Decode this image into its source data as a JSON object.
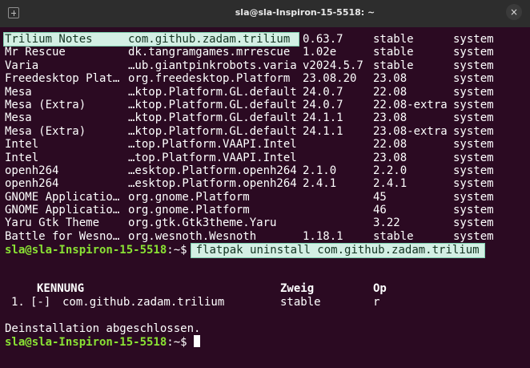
{
  "window": {
    "title": "sla@sla-Inspiron-15-5518: ~",
    "close_symbol": "×",
    "new_tab_icon": "new-tab-icon",
    "colors": {
      "background": "#2b0a22",
      "titlebar": "#2d2d2d",
      "prompt": "#8ae234",
      "highlight": "#d3efe4"
    }
  },
  "apps_table": {
    "rows": [
      {
        "name": "Trilium Notes",
        "id": "com.github.zadam.trilium",
        "version": "0.63.7",
        "branch": "stable",
        "installation": "system"
      },
      {
        "name": "Mr Rescue",
        "id": "dk.tangramgames.mrrescue",
        "version": "1.02e",
        "branch": "stable",
        "installation": "system"
      },
      {
        "name": "Varia",
        "id": "…ub.giantpinkrobots.varia",
        "version": "v2024.5.7",
        "branch": "stable",
        "installation": "system"
      },
      {
        "name": "Freedesktop Plat…",
        "id": "org.freedesktop.Platform",
        "version": "23.08.20",
        "branch": "23.08",
        "installation": "system"
      },
      {
        "name": "Mesa",
        "id": "…ktop.Platform.GL.default",
        "version": "24.0.7",
        "branch": "22.08",
        "installation": "system"
      },
      {
        "name": "Mesa (Extra)",
        "id": "…ktop.Platform.GL.default",
        "version": "24.0.7",
        "branch": "22.08-extra",
        "installation": "system"
      },
      {
        "name": "Mesa",
        "id": "…ktop.Platform.GL.default",
        "version": "24.1.1",
        "branch": "23.08",
        "installation": "system"
      },
      {
        "name": "Mesa (Extra)",
        "id": "…ktop.Platform.GL.default",
        "version": "24.1.1",
        "branch": "23.08-extra",
        "installation": "system"
      },
      {
        "name": "Intel",
        "id": "…top.Platform.VAAPI.Intel",
        "version": "",
        "branch": "22.08",
        "installation": "system"
      },
      {
        "name": "Intel",
        "id": "…top.Platform.VAAPI.Intel",
        "version": "",
        "branch": "23.08",
        "installation": "system"
      },
      {
        "name": "openh264",
        "id": "…esktop.Platform.openh264",
        "version": "2.1.0",
        "branch": "2.2.0",
        "installation": "system"
      },
      {
        "name": "openh264",
        "id": "…esktop.Platform.openh264",
        "version": "2.4.1",
        "branch": "2.4.1",
        "installation": "system"
      },
      {
        "name": "GNOME Applicatio…",
        "id": "org.gnome.Platform",
        "version": "",
        "branch": "45",
        "installation": "system"
      },
      {
        "name": "GNOME Applicatio…",
        "id": "org.gnome.Platform",
        "version": "",
        "branch": "46",
        "installation": "system"
      },
      {
        "name": "Yaru Gtk Theme",
        "id": "org.gtk.Gtk3theme.Yaru",
        "version": "",
        "branch": "3.22",
        "installation": "system"
      },
      {
        "name": "Battle for Wesno…",
        "id": "org.wesnoth.Wesnoth",
        "version": "1.18.1",
        "branch": "stable",
        "installation": "system"
      }
    ]
  },
  "command": {
    "prompt": "sla@sla-Inspiron-15-5518",
    "suffix": ":~$",
    "text": "flatpak uninstall com.github.zadam.trilium"
  },
  "uninstall_table": {
    "headers": {
      "id": "KENNUNG",
      "branch": "Zweig",
      "op": "Op"
    },
    "rows": [
      {
        "index": "1.",
        "mark": "[-]",
        "id": "com.github.zadam.trilium",
        "branch": "stable",
        "op": "r"
      }
    ]
  },
  "result_message": "Deinstallation abgeschlossen.",
  "final_prompt": {
    "prompt": "sla@sla-Inspiron-15-5518",
    "suffix": ":~$"
  }
}
